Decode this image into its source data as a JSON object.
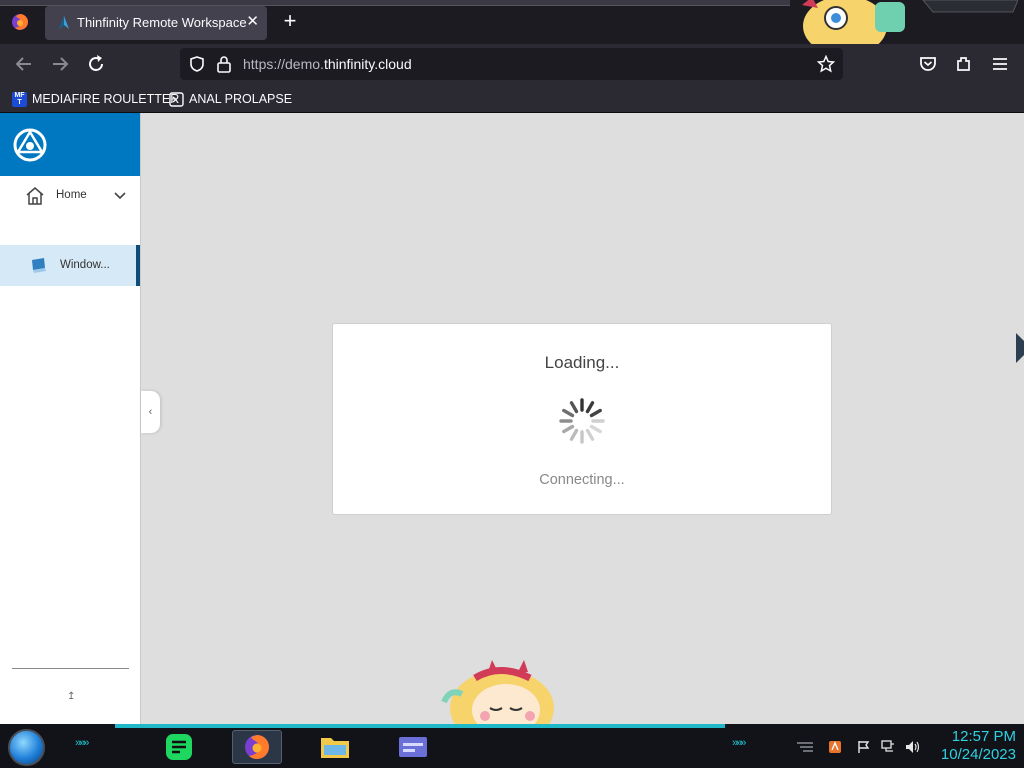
{
  "browser": {
    "tab": {
      "title": "Thinfinity Remote Workspace",
      "close": "✕"
    },
    "new_tab": "+",
    "url": {
      "prefix": "https://demo.",
      "domain": "thinfinity.cloud"
    },
    "bookmarks": [
      {
        "label": "MEDIAFIRE ROULETTER",
        "icon_text": "MF T",
        "icon": "mediafire-icon"
      },
      {
        "label": "ANAL PROLAPSE",
        "icon_text": "",
        "icon": "bookmark-page-icon"
      }
    ]
  },
  "sidebar": {
    "home_label": "Home",
    "selected_item_label": "Window...",
    "collapse_glyph": "‹",
    "pin_glyph": "↥"
  },
  "dialog": {
    "title": "Loading...",
    "status": "Connecting..."
  },
  "taskbar": {
    "time": "12:57 PM",
    "date": "10/24/2023",
    "chevrons": "»»»"
  },
  "colors": {
    "brand": "#0077c1",
    "selected_bg": "#d6e9f7",
    "page_bg": "#dedede",
    "clock": "#2fd1e0"
  }
}
